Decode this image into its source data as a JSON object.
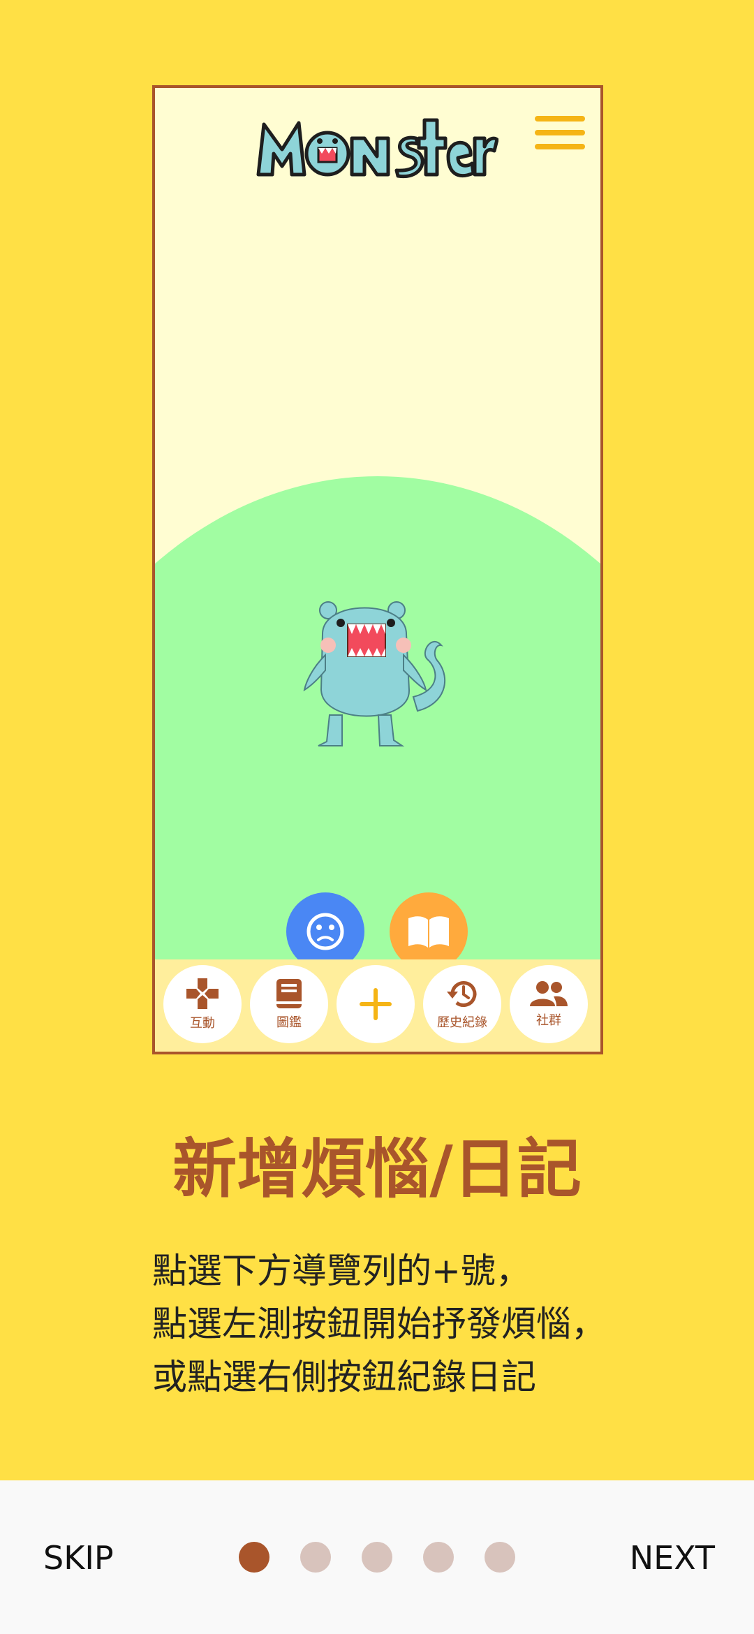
{
  "app": {
    "logo_text": "Monsters",
    "menu_icon": "hamburger-menu-icon"
  },
  "fabs": [
    {
      "name": "mood-vent-button",
      "icon": "neutral-face-icon",
      "color": "#4A87F4"
    },
    {
      "name": "diary-button",
      "icon": "open-book-icon",
      "color": "#FFAA3D"
    }
  ],
  "nav": {
    "interact_label": "互動",
    "collection_label": "圖鑑",
    "add_icon": "plus-icon",
    "history_label": "歷史紀錄",
    "community_label": "社群"
  },
  "onboarding": {
    "title": "新增煩惱/日記",
    "description_lines": [
      "點選下方導覽列的+號，",
      "點選左測按鈕開始抒發煩惱，",
      "或點選右側按鈕紀錄日記"
    ]
  },
  "footer": {
    "skip_label": "SKIP",
    "next_label": "NEXT",
    "page_count": 5,
    "current_page": 1
  },
  "colors": {
    "background": "#FFE045",
    "accent_brown": "#A9552B",
    "phone_bg": "#FFFDD2",
    "hill_green": "#A1FDA2",
    "nav_bg": "#FFEE9C",
    "menu_yellow": "#F5B415",
    "dot_inactive": "#D8C3BC"
  }
}
